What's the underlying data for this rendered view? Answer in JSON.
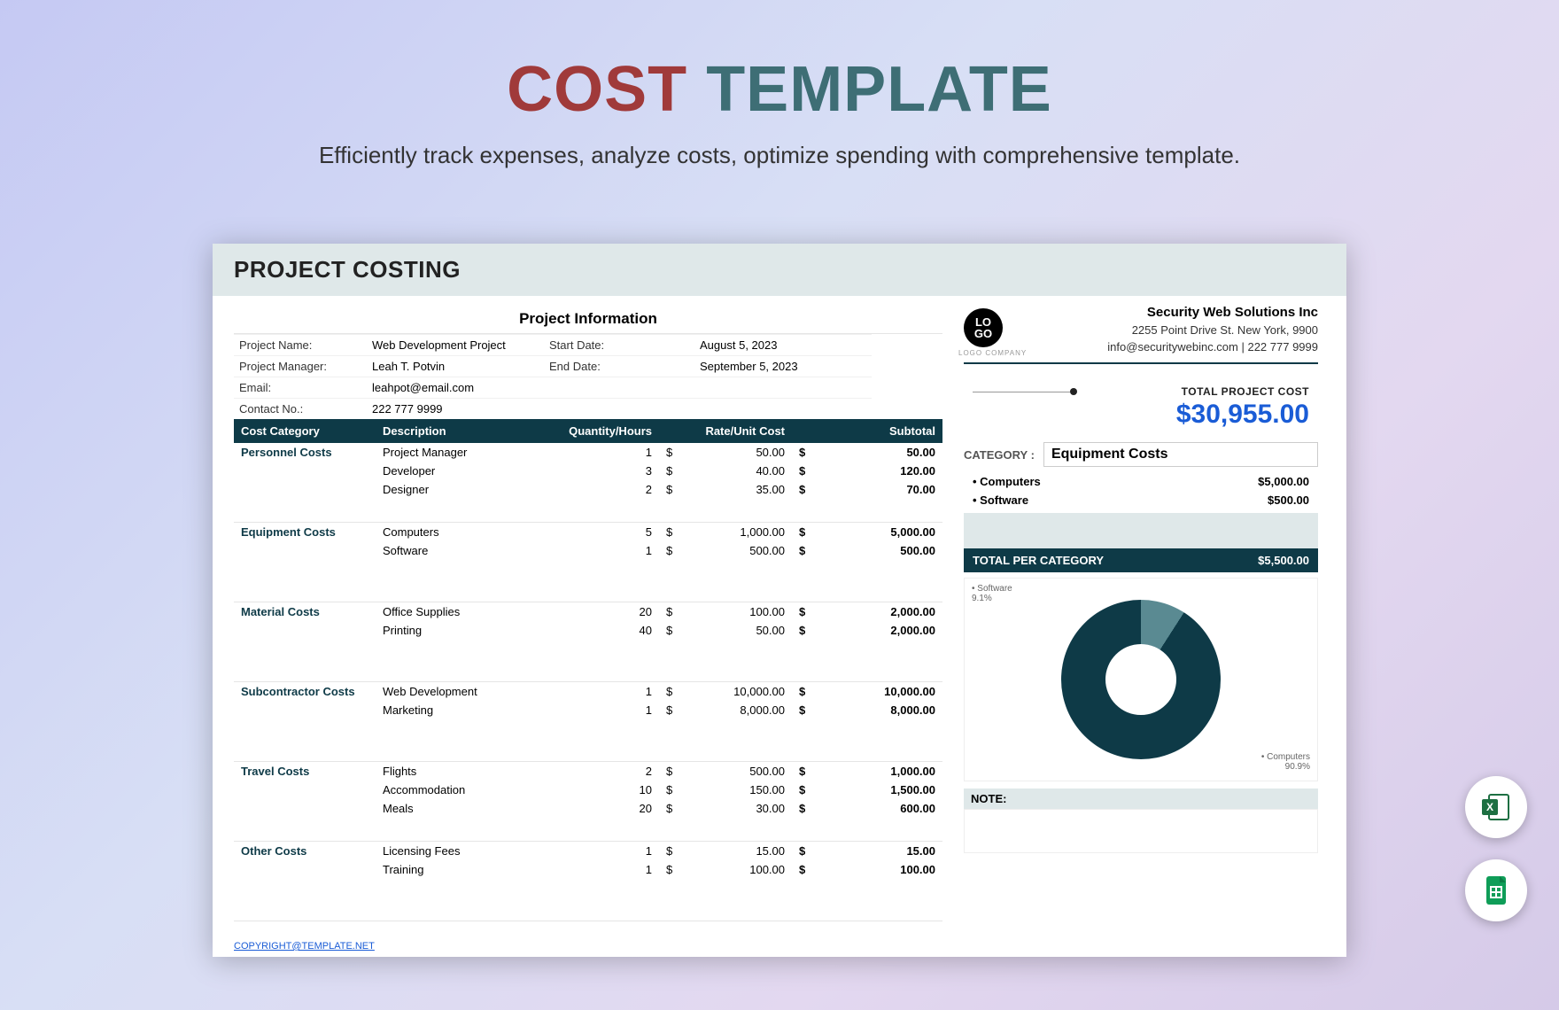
{
  "hero": {
    "title_word1": "COST",
    "title_word2": "TEMPLATE",
    "subtitle": "Efficiently track expenses, analyze costs, optimize spending with comprehensive template."
  },
  "sheet_title": "PROJECT COSTING",
  "project_info_title": "Project Information",
  "labels": {
    "project_name": "Project Name:",
    "project_manager": "Project Manager:",
    "email": "Email:",
    "contact": "Contact No.:",
    "start_date": "Start Date:",
    "end_date": "End Date:"
  },
  "info": {
    "project_name": "Web Development Project",
    "project_manager": "Leah T. Potvin",
    "email": "leahpot@email.com",
    "contact": "222 777 9999",
    "start_date": "August 5, 2023",
    "end_date": "September 5, 2023"
  },
  "headers": {
    "cat": "Cost Category",
    "desc": "Description",
    "qty": "Quantity/Hours",
    "rate": "Rate/Unit Cost",
    "sub": "Subtotal"
  },
  "cats": [
    {
      "name": "Personnel Costs",
      "rows": [
        {
          "d": "Project Manager",
          "q": "1",
          "r": "50.00",
          "s": "50.00"
        },
        {
          "d": "Developer",
          "q": "3",
          "r": "40.00",
          "s": "120.00"
        },
        {
          "d": "Designer",
          "q": "2",
          "r": "35.00",
          "s": "70.00"
        }
      ]
    },
    {
      "name": "Equipment Costs",
      "rows": [
        {
          "d": "Computers",
          "q": "5",
          "r": "1,000.00",
          "s": "5,000.00"
        },
        {
          "d": "Software",
          "q": "1",
          "r": "500.00",
          "s": "500.00"
        }
      ]
    },
    {
      "name": "Material Costs",
      "rows": [
        {
          "d": "Office Supplies",
          "q": "20",
          "r": "100.00",
          "s": "2,000.00"
        },
        {
          "d": "Printing",
          "q": "40",
          "r": "50.00",
          "s": "2,000.00"
        }
      ]
    },
    {
      "name": "Subcontractor Costs",
      "rows": [
        {
          "d": "Web Development",
          "q": "1",
          "r": "10,000.00",
          "s": "10,000.00"
        },
        {
          "d": "Marketing",
          "q": "1",
          "r": "8,000.00",
          "s": "8,000.00"
        }
      ]
    },
    {
      "name": "Travel Costs",
      "rows": [
        {
          "d": "Flights",
          "q": "2",
          "r": "500.00",
          "s": "1,000.00"
        },
        {
          "d": "Accommodation",
          "q": "10",
          "r": "150.00",
          "s": "1,500.00"
        },
        {
          "d": "Meals",
          "q": "20",
          "r": "30.00",
          "s": "600.00"
        }
      ]
    },
    {
      "name": "Other Costs",
      "rows": [
        {
          "d": "Licensing Fees",
          "q": "1",
          "r": "15.00",
          "s": "15.00"
        },
        {
          "d": "Training",
          "q": "1",
          "r": "100.00",
          "s": "100.00"
        }
      ]
    }
  ],
  "company": {
    "logo_text": "LO\nGO",
    "logo_caption": "LOGO COMPANY",
    "name": "Security Web Solutions Inc",
    "address": "2255  Point Drive St. New York, 9900",
    "contact_line": "info@securitywebinc.com  | 222 777 9999"
  },
  "total": {
    "label": "TOTAL PROJECT COST",
    "value": "$30,955.00"
  },
  "category_panel": {
    "label": "CATEGORY :",
    "selected": "Equipment Costs",
    "items": [
      {
        "name": "• Computers",
        "val": "$5,000.00"
      },
      {
        "name": "• Software",
        "val": "$500.00"
      }
    ],
    "total_label": "TOTAL PER CATEGORY",
    "total_val": "$5,500.00"
  },
  "donut": {
    "label1": "• Software",
    "pct1": "9.1%",
    "label2": "• Computers",
    "pct2": "90.9%"
  },
  "note_label": "NOTE:",
  "copyright": "COPYRIGHT@TEMPLATE.NET",
  "chart_data": {
    "type": "pie",
    "title": "Equipment Costs breakdown",
    "series": [
      {
        "name": "Software",
        "value": 500,
        "pct": 9.1
      },
      {
        "name": "Computers",
        "value": 5000,
        "pct": 90.9
      }
    ]
  }
}
